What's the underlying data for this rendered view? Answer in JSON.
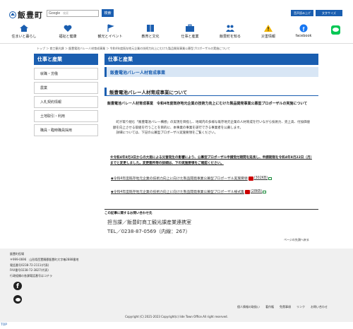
{
  "header": {
    "site_name": "飯豊町",
    "search": {
      "engine_label": "Google",
      "placeholder": "検索",
      "button": "検索"
    },
    "utility_buttons": [
      "音声読み上げ",
      "文字サイズ"
    ]
  },
  "nav": [
    {
      "label": "住まいと暮らし",
      "icon": "house-icon"
    },
    {
      "label": "福祉と健康",
      "icon": "heart-icon"
    },
    {
      "label": "観光とイベント",
      "icon": "flag-icon"
    },
    {
      "label": "教育と文化",
      "icon": "book-icon"
    },
    {
      "label": "仕事と産業",
      "icon": "briefcase-icon"
    },
    {
      "label": "飯豊町を知る",
      "icon": "people-icon"
    },
    {
      "label": "災害情報",
      "icon": "warning-icon"
    },
    {
      "label": "facebook",
      "icon": "facebook-icon"
    }
  ],
  "breadcrumb": "トップ ＞ 商工観光課 ＞ 飯豊電池バレー人材育成事業 ＞ 令和4年度既存地元企業の技術力向上にむけた製品開発事業公募型プロポーザルの実施について",
  "sidebar": {
    "title": "仕事と産業",
    "items": [
      "就職・労働",
      "農業",
      "入札契約情報",
      "土地取引・利用",
      "職員・臨時職員採用"
    ]
  },
  "main": {
    "title": "仕事と産業",
    "section_title": "飯豊電池バレー人材育成事業",
    "article_title": "飯豊電池バレー人材育成事業について",
    "lead": "飯豊電池バレー人材育成事業　令和4年度既存地元企業の技術力向上にむけた製品開発事業公募型プロポーザルの実施について",
    "body1": "町が取り組む「飯豊電池バレー構想」の実現を目指し、地域内の多様な既存地元企業の人材育成を行いながら技術力、売上高、付加価値額を向上させる取組を行うことを目的に、本事業の事業を遂行できる事業者を公募します。",
    "body2": "詳細については、下記の公募型プロポーザル実施要領をご覧ください。",
    "notice": "※令和4年8月3日からの大雨による災害発生の影響により、公募型プロポーザル申請受付期間を延長し、申請期限を令和4年8月22日（月）までと変更しました。変更箇所等の詳細は、下の実施要領をご確認ください。",
    "links": [
      {
        "text": "◆令和4年度既存地元企業の技術力向上に向けた製品開発事業公募型プロポーザル実施要領",
        "size": "(302KB)"
      },
      {
        "text": "◆令和4年度既存地元企業の技術力向上に向けた製品開発事業公募型プロポーザル様式集",
        "size": "(28KB)"
      }
    ],
    "contact_heading": "この記事に関するお問い合わせ先",
    "contact_dept": "担当課／飯豊町商工観光課産業連携室",
    "contact_tel": "TEL／0238-87-0569（内線：267）",
    "page_top": "ページの先頭へ戻る"
  },
  "footer": {
    "address": "飯豊町役場\n〒999-0696　山形県西置賜郡飯豊町大字椿2888番地\n電話番号0238-72-2111(代表)\nFAX番号0238-72-3827(代表)\n行政組織の各課電話番号はコチラ",
    "links": [
      "個人情報の取扱い",
      "著作権",
      "免責事項",
      "リンク",
      "お問い合わせ"
    ],
    "copyright": "Copyright (C) 2021-2023 Copyright(c) Iide Town Office.All right reserved.",
    "top": "TOP"
  },
  "colors": {
    "primary": "#1a5eb0",
    "light_blue": "#d8e6f5",
    "line_green": "#06c755"
  }
}
